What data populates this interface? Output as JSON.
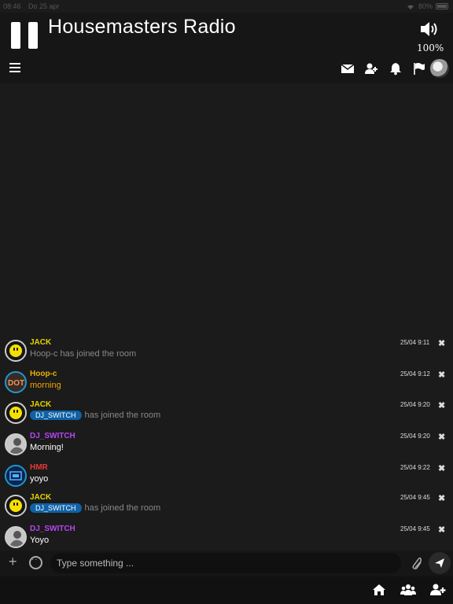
{
  "status_bar": {
    "time": "08:46",
    "date": "Do 25 apr",
    "battery": "80%"
  },
  "player": {
    "title": "Housemasters Radio",
    "volume": "100%"
  },
  "composer": {
    "placeholder": "Type something ..."
  },
  "messages": [
    {
      "user": "JACK",
      "user_color": "#e6d300",
      "text": "Hoop-c has joined the room",
      "time": "25/04 9:11",
      "close": "✖"
    },
    {
      "user": "Hoop-c",
      "user_color": "#e9b000",
      "text": "morning",
      "text_color": "#f0a500",
      "time": "25/04 9:12",
      "close": "✖"
    },
    {
      "user": "JACK",
      "user_color": "#e6d300",
      "tag": "DJ_SWITCH",
      "text": "has joined the room",
      "time": "25/04 9:20",
      "close": "✖"
    },
    {
      "user": "DJ_SWITCH",
      "user_color": "#b646f2",
      "text": "Morning!",
      "time": "25/04 9:20",
      "close": "✖"
    },
    {
      "user": "HMR",
      "user_color": "#e53935",
      "text": "yoyo",
      "time": "25/04 9:22",
      "close": "✖"
    },
    {
      "user": "JACK",
      "user_color": "#e6d300",
      "tag": "DJ_SWITCH",
      "text": "has joined the room",
      "time": "25/04 9:45",
      "close": "✖"
    },
    {
      "user": "DJ_SWITCH",
      "user_color": "#b646f2",
      "text": "Yoyo",
      "time": "25/04 9:45",
      "close": "✖"
    }
  ],
  "colors": {
    "accent_tag": "#0f62a6",
    "background": "#1b1b1b"
  }
}
